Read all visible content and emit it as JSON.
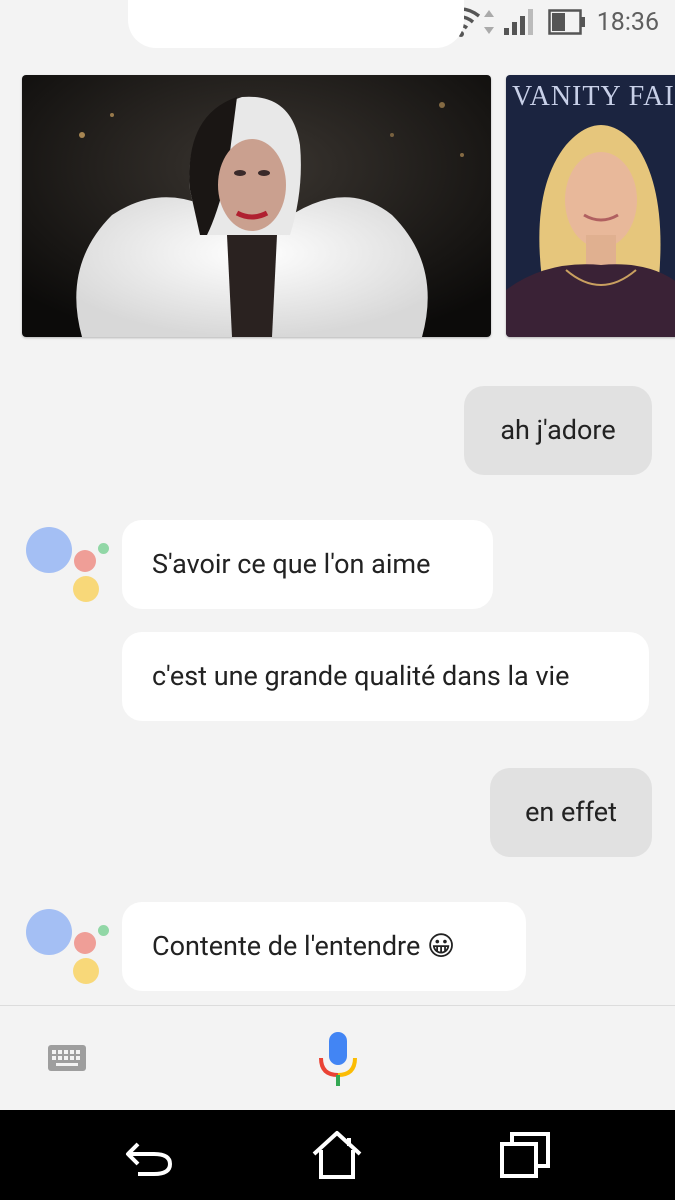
{
  "status_bar": {
    "time": "18:36",
    "icons": [
      "vibrate-icon",
      "wifi-icon",
      "cell-signal-icon",
      "battery-icon"
    ]
  },
  "images": [
    {
      "name": "result-image-1",
      "description": "woman-white-fur-coat"
    },
    {
      "name": "result-image-2",
      "description": "blonde-woman-portrait",
      "magazine_text": "VANITY FAIR"
    }
  ],
  "messages": [
    {
      "role": "user",
      "text": "ah j'adore"
    },
    {
      "role": "assistant",
      "text": "S'avoir ce que l'on aime"
    },
    {
      "role": "assistant",
      "text": "c'est une grande qualité dans la vie"
    },
    {
      "role": "user",
      "text": "en effet"
    },
    {
      "role": "assistant",
      "text": "Contente de l'entendre 😀"
    }
  ],
  "input_bar": {
    "keyboard_icon": "keyboard-icon",
    "mic_icon": "microphone-icon"
  },
  "nav_bar": {
    "icons": [
      "back-icon",
      "home-icon",
      "recents-icon"
    ]
  },
  "colors": {
    "background": "#f3f3f3",
    "user_bubble": "#e1e1e1",
    "assistant_bubble": "#ffffff",
    "ga_blue": "#a4bff4",
    "ga_red": "#ef9e97",
    "ga_yellow": "#f8d879",
    "ga_green": "#91d7a6"
  }
}
